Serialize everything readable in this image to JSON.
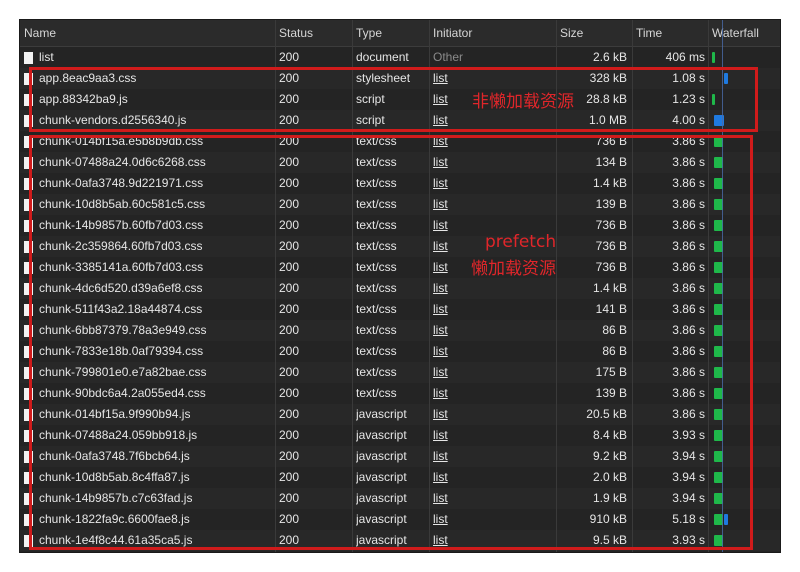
{
  "header": {
    "name": "Name",
    "status": "Status",
    "type": "Type",
    "initiator": "Initiator",
    "size": "Size",
    "time": "Time",
    "waterfall": "Waterfall"
  },
  "colors": {
    "panel_bg": "#242424",
    "annotation_red": "#d01b1b",
    "bar_green": "#1db954",
    "bar_blue": "#1f7ae0"
  },
  "rows": [
    {
      "name": "list",
      "status": "200",
      "type": "document",
      "initiator": "Other",
      "initiator_link": false,
      "size": "2.6 kB",
      "time": "406 ms",
      "bars": [
        "green-thin"
      ]
    },
    {
      "name": "app.8eac9aa3.css",
      "status": "200",
      "type": "stylesheet",
      "initiator": "list",
      "initiator_link": true,
      "size": "328 kB",
      "time": "1.08 s",
      "bars": [
        "blue-small"
      ]
    },
    {
      "name": "app.88342ba9.js",
      "status": "200",
      "type": "script",
      "initiator": "list",
      "initiator_link": true,
      "size": "28.8 kB",
      "time": "1.23 s",
      "bars": [
        "green-thin"
      ]
    },
    {
      "name": "chunk-vendors.d2556340.js",
      "status": "200",
      "type": "script",
      "initiator": "list",
      "initiator_link": true,
      "size": "1.0 MB",
      "time": "4.00 s",
      "bars": [
        "blue-wide"
      ]
    },
    {
      "name": "chunk-014bf15a.e5b8b9db.css",
      "status": "200",
      "type": "text/css",
      "initiator": "list",
      "initiator_link": true,
      "size": "736 B",
      "time": "3.86 s",
      "bars": [
        "green"
      ]
    },
    {
      "name": "chunk-07488a24.0d6c6268.css",
      "status": "200",
      "type": "text/css",
      "initiator": "list",
      "initiator_link": true,
      "size": "134 B",
      "time": "3.86 s",
      "bars": [
        "green"
      ]
    },
    {
      "name": "chunk-0afa3748.9d221971.css",
      "status": "200",
      "type": "text/css",
      "initiator": "list",
      "initiator_link": true,
      "size": "1.4 kB",
      "time": "3.86 s",
      "bars": [
        "green"
      ]
    },
    {
      "name": "chunk-10d8b5ab.60c581c5.css",
      "status": "200",
      "type": "text/css",
      "initiator": "list",
      "initiator_link": true,
      "size": "139 B",
      "time": "3.86 s",
      "bars": [
        "green"
      ]
    },
    {
      "name": "chunk-14b9857b.60fb7d03.css",
      "status": "200",
      "type": "text/css",
      "initiator": "list",
      "initiator_link": true,
      "size": "736 B",
      "time": "3.86 s",
      "bars": [
        "green"
      ]
    },
    {
      "name": "chunk-2c359864.60fb7d03.css",
      "status": "200",
      "type": "text/css",
      "initiator": "list",
      "initiator_link": true,
      "size": "736 B",
      "time": "3.86 s",
      "bars": [
        "green"
      ]
    },
    {
      "name": "chunk-3385141a.60fb7d03.css",
      "status": "200",
      "type": "text/css",
      "initiator": "list",
      "initiator_link": true,
      "size": "736 B",
      "time": "3.86 s",
      "bars": [
        "green"
      ]
    },
    {
      "name": "chunk-4dc6d520.d39a6ef8.css",
      "status": "200",
      "type": "text/css",
      "initiator": "list",
      "initiator_link": true,
      "size": "1.4 kB",
      "time": "3.86 s",
      "bars": [
        "green"
      ]
    },
    {
      "name": "chunk-511f43a2.18a44874.css",
      "status": "200",
      "type": "text/css",
      "initiator": "list",
      "initiator_link": true,
      "size": "141 B",
      "time": "3.86 s",
      "bars": [
        "green"
      ]
    },
    {
      "name": "chunk-6bb87379.78a3e949.css",
      "status": "200",
      "type": "text/css",
      "initiator": "list",
      "initiator_link": true,
      "size": "86 B",
      "time": "3.86 s",
      "bars": [
        "green"
      ]
    },
    {
      "name": "chunk-7833e18b.0af79394.css",
      "status": "200",
      "type": "text/css",
      "initiator": "list",
      "initiator_link": true,
      "size": "86 B",
      "time": "3.86 s",
      "bars": [
        "green"
      ]
    },
    {
      "name": "chunk-799801e0.e7a82bae.css",
      "status": "200",
      "type": "text/css",
      "initiator": "list",
      "initiator_link": true,
      "size": "175 B",
      "time": "3.86 s",
      "bars": [
        "green"
      ]
    },
    {
      "name": "chunk-90bdc6a4.2a055ed4.css",
      "status": "200",
      "type": "text/css",
      "initiator": "list",
      "initiator_link": true,
      "size": "139 B",
      "time": "3.86 s",
      "bars": [
        "green"
      ]
    },
    {
      "name": "chunk-014bf15a.9f990b94.js",
      "status": "200",
      "type": "javascript",
      "initiator": "list",
      "initiator_link": true,
      "size": "20.5 kB",
      "time": "3.86 s",
      "bars": [
        "green"
      ]
    },
    {
      "name": "chunk-07488a24.059bb918.js",
      "status": "200",
      "type": "javascript",
      "initiator": "list",
      "initiator_link": true,
      "size": "8.4 kB",
      "time": "3.93 s",
      "bars": [
        "green"
      ]
    },
    {
      "name": "chunk-0afa3748.7f6bcb64.js",
      "status": "200",
      "type": "javascript",
      "initiator": "list",
      "initiator_link": true,
      "size": "9.2 kB",
      "time": "3.94 s",
      "bars": [
        "green"
      ]
    },
    {
      "name": "chunk-10d8b5ab.8c4ffa87.js",
      "status": "200",
      "type": "javascript",
      "initiator": "list",
      "initiator_link": true,
      "size": "2.0 kB",
      "time": "3.94 s",
      "bars": [
        "green"
      ]
    },
    {
      "name": "chunk-14b9857b.c7c63fad.js",
      "status": "200",
      "type": "javascript",
      "initiator": "list",
      "initiator_link": true,
      "size": "1.9 kB",
      "time": "3.94 s",
      "bars": [
        "green"
      ]
    },
    {
      "name": "chunk-1822fa9c.6600fae8.js",
      "status": "200",
      "type": "javascript",
      "initiator": "list",
      "initiator_link": true,
      "size": "910 kB",
      "time": "5.18 s",
      "bars": [
        "green",
        "blue-small"
      ]
    },
    {
      "name": "chunk-1e4f8c44.61a35ca5.js",
      "status": "200",
      "type": "javascript",
      "initiator": "list",
      "initiator_link": true,
      "size": "9.5 kB",
      "time": "3.93 s",
      "bars": [
        "green"
      ]
    }
  ],
  "annotations": {
    "non_lazy": "非懒加载资源",
    "prefetch_line1": "prefetch",
    "prefetch_line2": "懒加载资源"
  }
}
